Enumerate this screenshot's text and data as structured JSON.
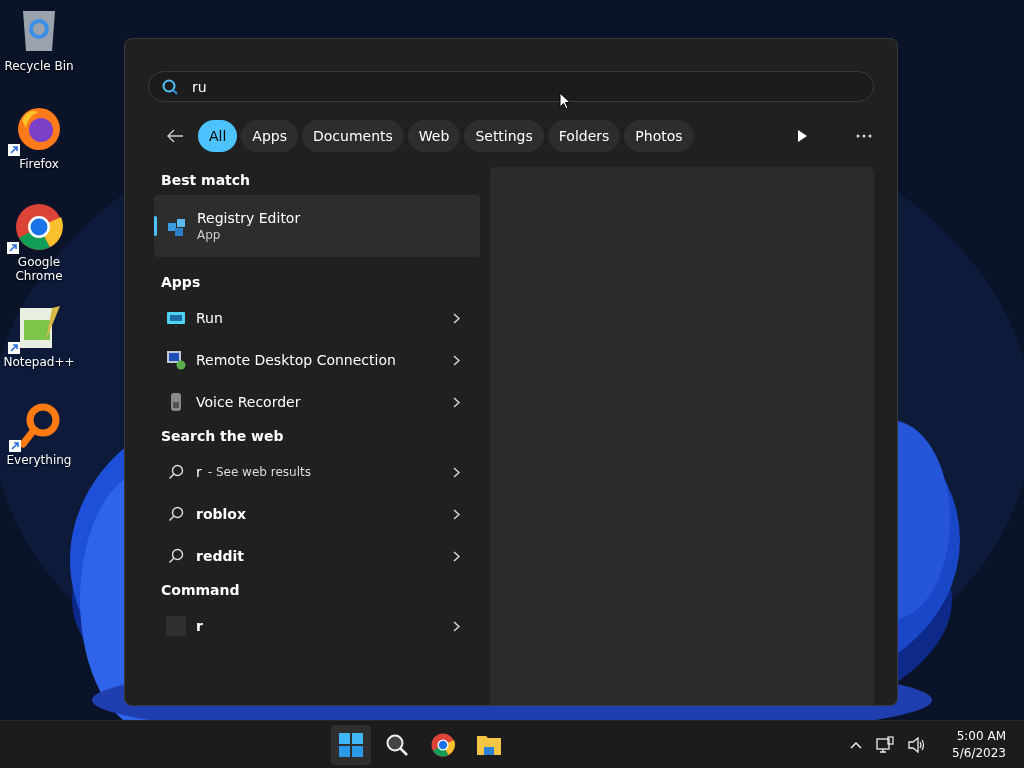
{
  "desktop_icons": [
    {
      "kind": "recycle",
      "label": "Recycle Bin",
      "shortcut": false
    },
    {
      "kind": "firefox",
      "label": "Firefox",
      "shortcut": true
    },
    {
      "kind": "chrome",
      "label": "Google Chrome",
      "shortcut": true
    },
    {
      "kind": "notepad",
      "label": "Notepad++",
      "shortcut": true
    },
    {
      "kind": "everything",
      "label": "Everything",
      "shortcut": true
    }
  ],
  "search": {
    "value": "ru"
  },
  "filters": [
    {
      "label": "All",
      "selected": true
    },
    {
      "label": "Apps",
      "selected": false
    },
    {
      "label": "Documents",
      "selected": false
    },
    {
      "label": "Web",
      "selected": false
    },
    {
      "label": "Settings",
      "selected": false
    },
    {
      "label": "Folders",
      "selected": false
    },
    {
      "label": "Photos",
      "selected": false
    }
  ],
  "best_match": {
    "heading": "Best match",
    "title": "Registry Editor",
    "subtitle": "App",
    "selected": true
  },
  "sections": [
    {
      "heading": "Apps",
      "items": [
        {
          "kind": "run",
          "label": "Run"
        },
        {
          "kind": "remote",
          "label": "Remote Desktop Connection"
        },
        {
          "kind": "recorder",
          "label": "Voice Recorder"
        }
      ]
    },
    {
      "heading": "Search the web",
      "items": [
        {
          "kind": "query",
          "label": "r",
          "note": "- See web results"
        },
        {
          "kind": "suggestion",
          "label": "roblox"
        },
        {
          "kind": "suggestion",
          "label": "reddit"
        }
      ]
    },
    {
      "heading": "Command",
      "items": [
        {
          "kind": "command",
          "label": "r"
        }
      ]
    }
  ],
  "taskbar": {
    "apps": [
      {
        "kind": "start",
        "selected": true
      },
      {
        "kind": "search",
        "selected": false
      },
      {
        "kind": "chrome",
        "selected": false
      },
      {
        "kind": "explorer",
        "selected": false
      }
    ],
    "time": "5:00 AM",
    "date": "5/6/2023"
  }
}
